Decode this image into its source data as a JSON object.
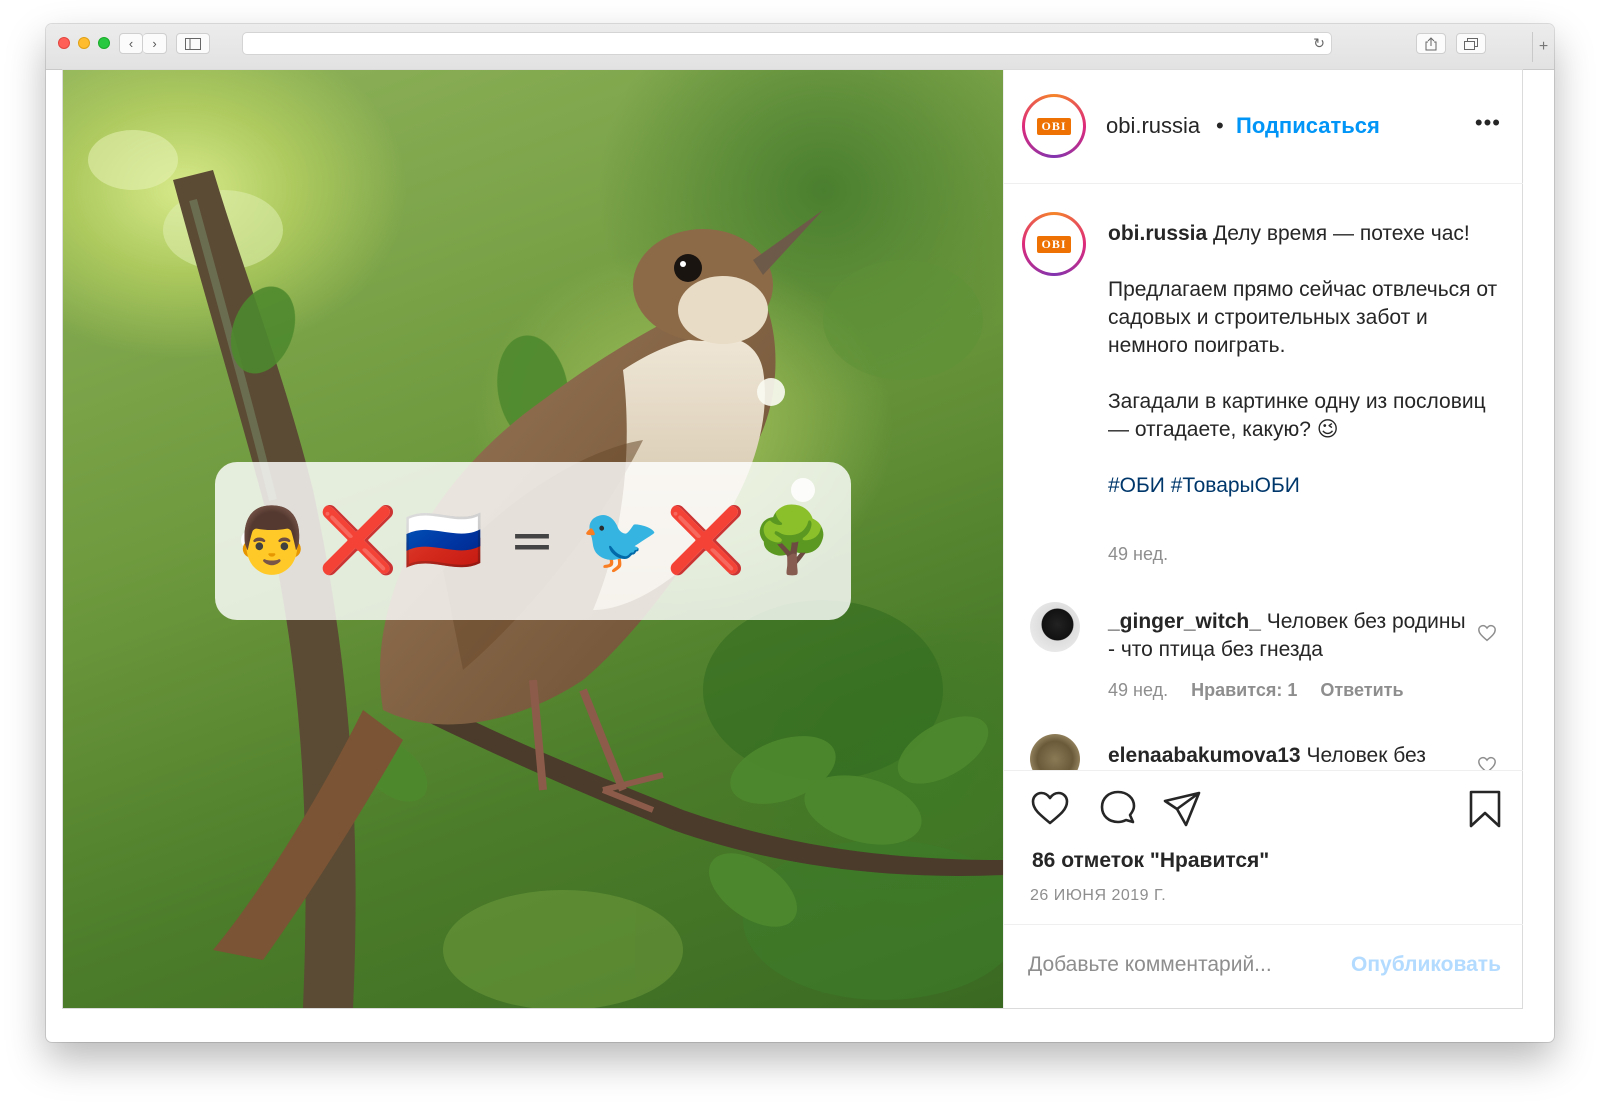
{
  "browser": {
    "back": "‹",
    "forward": "›",
    "reload": "↻",
    "new_tab": "+"
  },
  "post": {
    "rebus": {
      "man": "👨",
      "cross1": "❌",
      "flag": "🇷🇺",
      "equals": "=",
      "bird": "🐦",
      "cross2": "❌",
      "tree": "🌳"
    },
    "brand_logo": "OBI"
  },
  "header": {
    "username": "obi.russia",
    "dot": "•",
    "follow": "Подписаться",
    "more": "•••"
  },
  "caption": {
    "username": "obi.russia",
    "line1": "Делу время — потехе час!",
    "para2": "Предлагаем прямо сейчас отвлечься от садовых и строительных забот и немного поиграть.",
    "para3": "Загадали в картинке одну из пословиц — отгадаете, какую? 😉",
    "hashtags": "#ОБИ #ТоварыОБИ",
    "time": "49 нед."
  },
  "comments": [
    {
      "username": "_ginger_witch_",
      "text": "Человек без родины - что птица без гнезда",
      "time": "49 нед.",
      "likes": "Нравится: 1",
      "reply": "Ответить"
    },
    {
      "username": "elenaabakumova13",
      "text": "Человек без"
    }
  ],
  "actions": {
    "likes": "86 отметок \"Нравится\"",
    "date": "26 ИЮНЯ 2019 Г."
  },
  "add_comment": {
    "placeholder": "Добавьте комментарий...",
    "post": "Опубликовать"
  },
  "colors": {
    "accent": "#0095f6",
    "post_disabled": "#b3dbff",
    "muted": "#8e8e8e"
  }
}
